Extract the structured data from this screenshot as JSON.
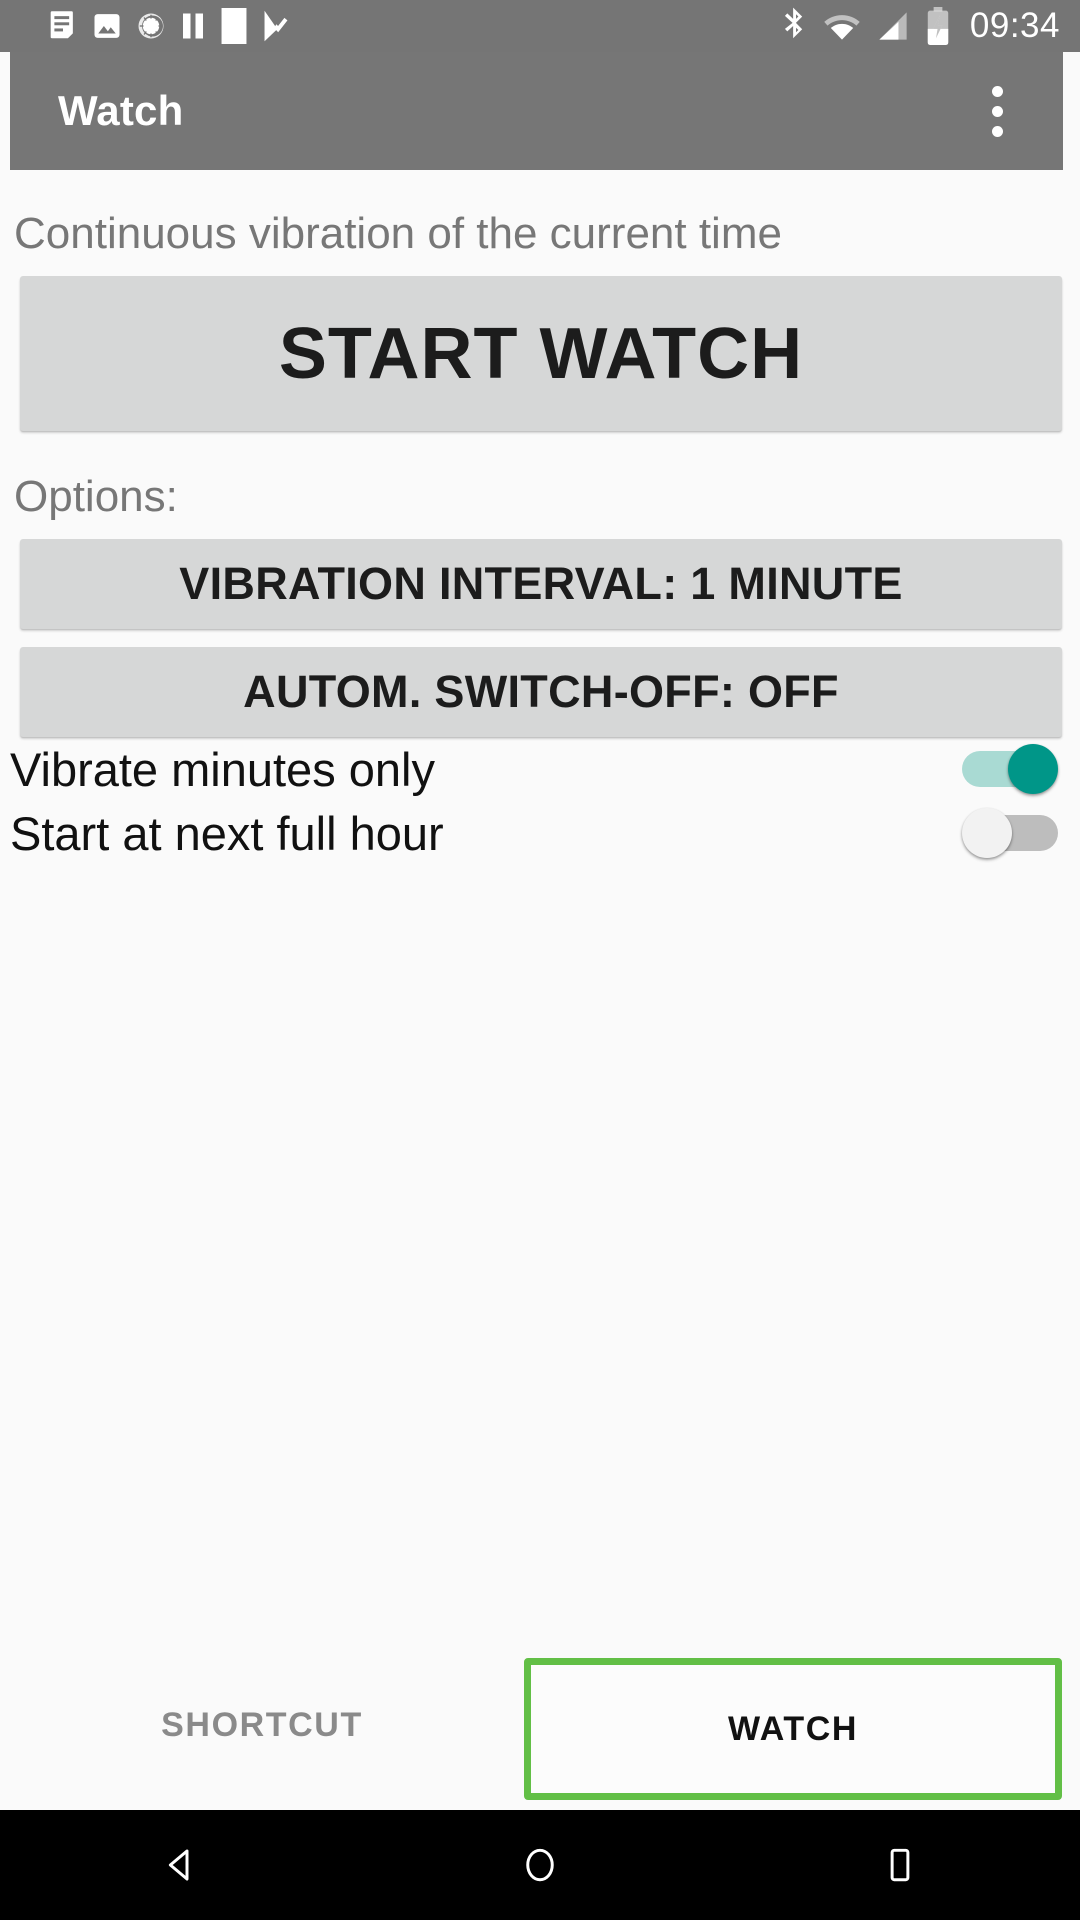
{
  "status_bar": {
    "time": "09:34",
    "background_color": "#757575",
    "left_icons": [
      {
        "name": "notification-document-icon",
        "glyph": "document"
      },
      {
        "name": "image-icon",
        "glyph": "photo"
      },
      {
        "name": "sync-spinner-icon",
        "glyph": "spinner"
      },
      {
        "name": "media-pause-icon",
        "glyph": "pause"
      },
      {
        "name": "blank-notification-icon",
        "glyph": "square"
      },
      {
        "name": "play-check-icon",
        "glyph": "play-check"
      }
    ],
    "right_icons": [
      {
        "name": "bluetooth-icon",
        "glyph": "bluetooth"
      },
      {
        "name": "wifi-icon",
        "glyph": "wifi"
      },
      {
        "name": "cellular-signal-icon",
        "glyph": "signal"
      },
      {
        "name": "battery-charging-icon",
        "glyph": "battery-charging"
      }
    ]
  },
  "app_bar": {
    "title": "Watch",
    "overflow_label": "More options",
    "background_color": "#767676",
    "title_color": "#ffffff"
  },
  "main": {
    "caption": "Continuous vibration of the current time",
    "start_button": "START WATCH",
    "options_label": "Options:",
    "option_buttons": [
      {
        "name": "vibration-interval-button",
        "label": "VIBRATION INTERVAL: 1 MINUTE"
      },
      {
        "name": "auto-switch-off-button",
        "label": "AUTOM. SWITCH-OFF: OFF"
      }
    ],
    "toggles": [
      {
        "name": "vibrate-minutes-only",
        "label": "Vibrate minutes only",
        "state": "on",
        "on_color": "#009688"
      },
      {
        "name": "start-at-next-full-hour",
        "label": "Start at next full hour",
        "state": "off",
        "off_color": "#bdbdbd"
      }
    ],
    "button_color": "#d6d7d7"
  },
  "tabs": {
    "shortcut_label": "SHORTCUT",
    "watch_label": "WATCH",
    "selected": "WATCH",
    "highlight_color": "#62bf46"
  },
  "nav_bar": {
    "back_label": "Back",
    "home_label": "Home",
    "recents_label": "Recents",
    "background_color": "#000000"
  }
}
